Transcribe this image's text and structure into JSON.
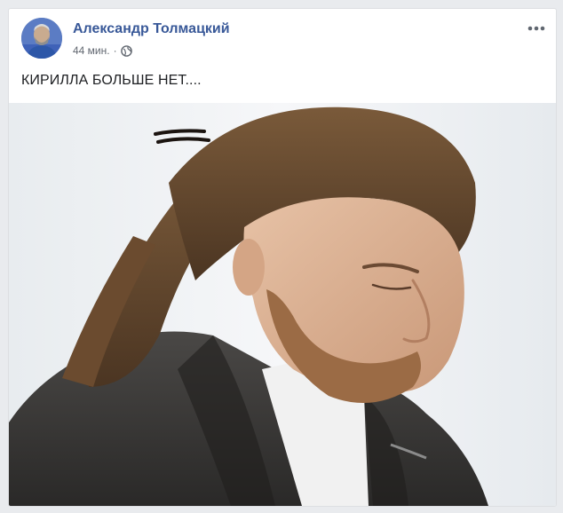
{
  "post": {
    "author": "Александр Толмацкий",
    "time": "44 мин.",
    "separator": "·",
    "privacy_icon": "globe-icon",
    "more_icon": "more-options-icon",
    "text": "КИРИЛЛА БОЛЬШЕ НЕТ....",
    "photo": "photo of a bearded man with long dreadlocks looking down, wearing a dark coat and white shirt"
  },
  "colors": {
    "author": "#385898",
    "meta": "#616770",
    "text": "#1c1e21",
    "page_bg": "#e9ebee"
  }
}
